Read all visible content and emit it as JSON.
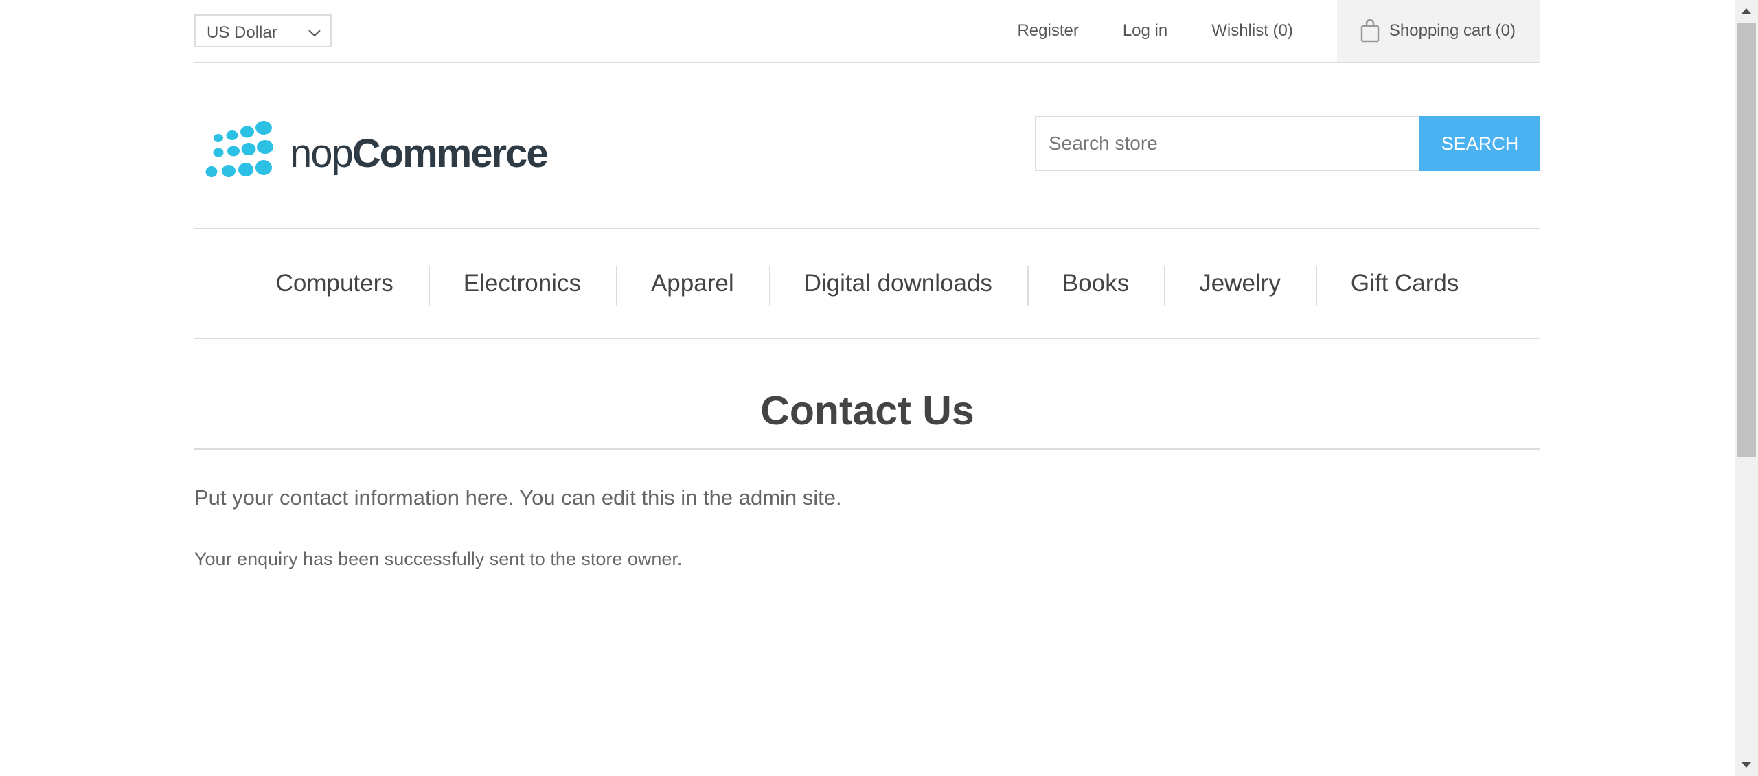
{
  "header": {
    "currency": "US Dollar",
    "register": "Register",
    "login": "Log in",
    "wishlist": "Wishlist (0)",
    "cart": "Shopping cart (0)",
    "cart_icon": "shopping-bag-icon"
  },
  "logo": {
    "prefix": "nop",
    "brand": "Commerce",
    "color": "#2bc0e4"
  },
  "search": {
    "placeholder": "Search store",
    "button": "SEARCH",
    "button_color": "#4ab2f1"
  },
  "nav": {
    "items": [
      {
        "label": "Computers"
      },
      {
        "label": "Electronics"
      },
      {
        "label": "Apparel"
      },
      {
        "label": "Digital downloads"
      },
      {
        "label": "Books"
      },
      {
        "label": "Jewelry"
      },
      {
        "label": "Gift Cards"
      }
    ]
  },
  "content": {
    "title": "Contact Us",
    "topic": "Put your contact information here. You can edit this in the admin site.",
    "result": "Your enquiry has been successfully sent to the store owner."
  }
}
